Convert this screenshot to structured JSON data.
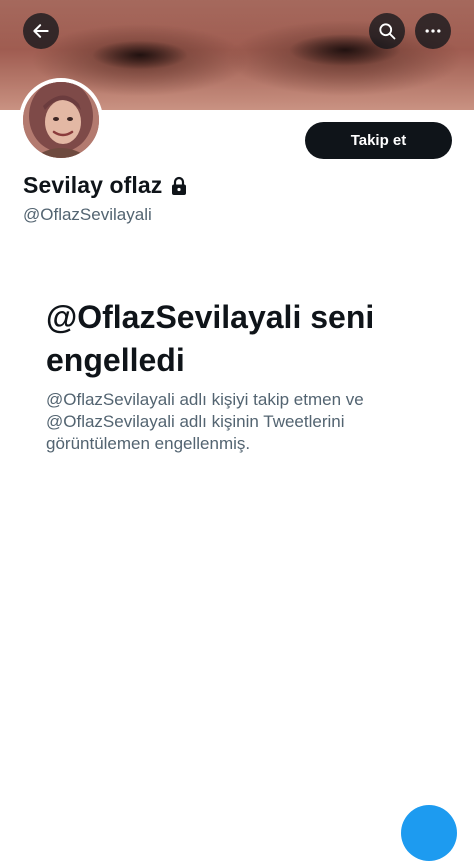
{
  "header": {
    "back_icon": "arrow-left-icon",
    "search_icon": "search-icon",
    "more_icon": "more-horizontal-icon"
  },
  "profile": {
    "display_name": "Sevilay oflaz",
    "protected_icon": "lock-icon",
    "handle": "@OflazSevilayali",
    "follow_label": "Takip et"
  },
  "blocked": {
    "title": "@OflazSevilayali seni engelledi",
    "description": "@OflazSevilayali adlı kişiyi takip etmen ve @OflazSevilayali adlı kişinin Tweetlerini görüntülemen engellenmiş."
  },
  "colors": {
    "primary_text": "#0f1419",
    "secondary_text": "#536471",
    "button_bg": "#0f1419",
    "accent": "#1d9bf0"
  }
}
